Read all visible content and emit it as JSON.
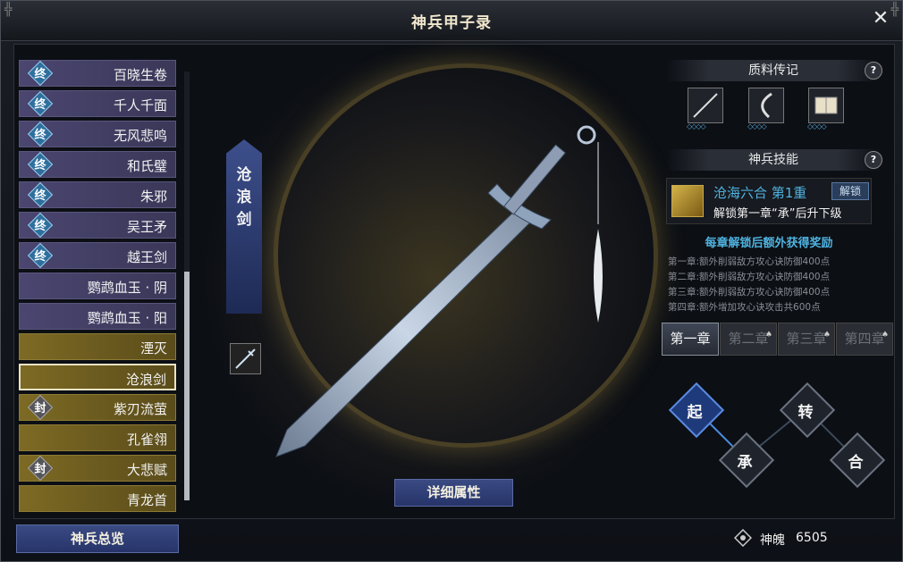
{
  "window": {
    "title": "神兵甲子录",
    "close_glyph": "✕"
  },
  "list": {
    "items": [
      {
        "label": "百晓生卷",
        "badge": "终",
        "style": "purple"
      },
      {
        "label": "千人千面",
        "badge": "终",
        "style": "purple"
      },
      {
        "label": "无风悲鸣",
        "badge": "终",
        "style": "purple"
      },
      {
        "label": "和氏璧",
        "badge": "终",
        "style": "purple"
      },
      {
        "label": "朱邪",
        "badge": "终",
        "style": "purple"
      },
      {
        "label": "吴王矛",
        "badge": "终",
        "style": "purple"
      },
      {
        "label": "越王剑",
        "badge": "终",
        "style": "purple"
      },
      {
        "label": "鹦鹉血玉 · 阴",
        "badge": "",
        "style": "purple"
      },
      {
        "label": "鹦鹉血玉 · 阳",
        "badge": "",
        "style": "purple"
      },
      {
        "label": "湮灭",
        "badge": "",
        "style": "gold"
      },
      {
        "label": "沧浪剑",
        "badge": "",
        "style": "gold",
        "selected": true
      },
      {
        "label": "紫刃流萤",
        "badge": "封",
        "style": "gold"
      },
      {
        "label": "孔雀翎",
        "badge": "",
        "style": "gold"
      },
      {
        "label": "大悲赋",
        "badge": "封",
        "style": "gold"
      },
      {
        "label": "青龙首",
        "badge": "",
        "style": "gold"
      }
    ],
    "overview_button": "神兵总览"
  },
  "center": {
    "weapon_name_vertical": "沧\n浪\n剑",
    "detail_button": "详细属性"
  },
  "right": {
    "lore_title": "质料传记",
    "help_glyph": "?",
    "skill_title": "神兵技能",
    "skill": {
      "name": "沧海六合 第1重",
      "unlock_label": "解锁",
      "desc": "解锁第一章“承”后升下级"
    },
    "reward_head": "每章解锁后额外获得奖励",
    "rewards": [
      "第一章:额外削弱敌方攻心诀防御400点",
      "第二章:额外削弱敌方攻心诀防御400点",
      "第三章:额外削弱敌方攻心诀防御400点",
      "第四章:额外增加攻心诀攻击共600点"
    ],
    "chapters": [
      "第一章",
      "第二章",
      "第三章",
      "第四章"
    ],
    "nodes": [
      "起",
      "承",
      "转",
      "合"
    ]
  },
  "currency": {
    "label": "神魄",
    "value": "6505"
  }
}
